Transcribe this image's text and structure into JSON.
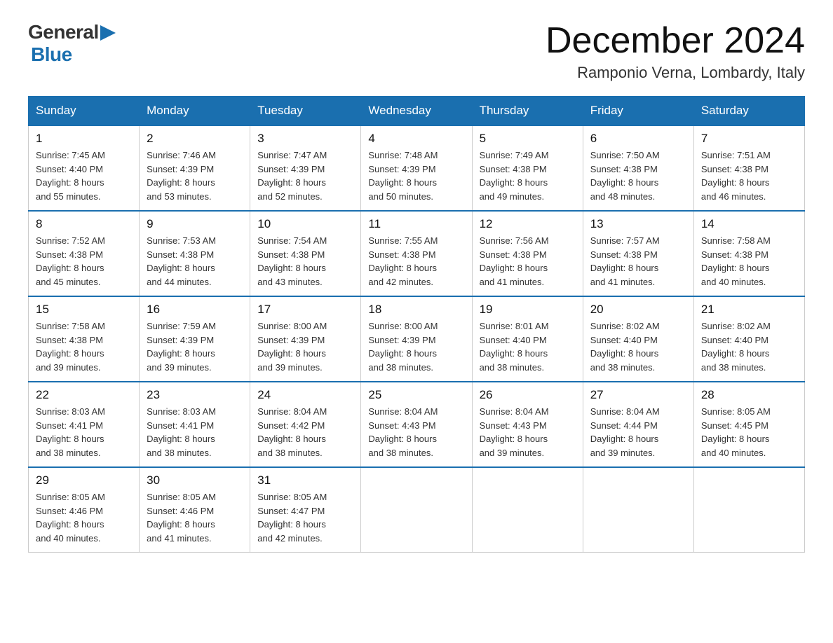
{
  "header": {
    "logo_general": "General",
    "logo_blue": "Blue",
    "month_title": "December 2024",
    "location": "Ramponio Verna, Lombardy, Italy"
  },
  "days_of_week": [
    "Sunday",
    "Monday",
    "Tuesday",
    "Wednesday",
    "Thursday",
    "Friday",
    "Saturday"
  ],
  "weeks": [
    [
      {
        "day": "1",
        "sunrise": "7:45 AM",
        "sunset": "4:40 PM",
        "daylight": "8 hours and 55 minutes."
      },
      {
        "day": "2",
        "sunrise": "7:46 AM",
        "sunset": "4:39 PM",
        "daylight": "8 hours and 53 minutes."
      },
      {
        "day": "3",
        "sunrise": "7:47 AM",
        "sunset": "4:39 PM",
        "daylight": "8 hours and 52 minutes."
      },
      {
        "day": "4",
        "sunrise": "7:48 AM",
        "sunset": "4:39 PM",
        "daylight": "8 hours and 50 minutes."
      },
      {
        "day": "5",
        "sunrise": "7:49 AM",
        "sunset": "4:38 PM",
        "daylight": "8 hours and 49 minutes."
      },
      {
        "day": "6",
        "sunrise": "7:50 AM",
        "sunset": "4:38 PM",
        "daylight": "8 hours and 48 minutes."
      },
      {
        "day": "7",
        "sunrise": "7:51 AM",
        "sunset": "4:38 PM",
        "daylight": "8 hours and 46 minutes."
      }
    ],
    [
      {
        "day": "8",
        "sunrise": "7:52 AM",
        "sunset": "4:38 PM",
        "daylight": "8 hours and 45 minutes."
      },
      {
        "day": "9",
        "sunrise": "7:53 AM",
        "sunset": "4:38 PM",
        "daylight": "8 hours and 44 minutes."
      },
      {
        "day": "10",
        "sunrise": "7:54 AM",
        "sunset": "4:38 PM",
        "daylight": "8 hours and 43 minutes."
      },
      {
        "day": "11",
        "sunrise": "7:55 AM",
        "sunset": "4:38 PM",
        "daylight": "8 hours and 42 minutes."
      },
      {
        "day": "12",
        "sunrise": "7:56 AM",
        "sunset": "4:38 PM",
        "daylight": "8 hours and 41 minutes."
      },
      {
        "day": "13",
        "sunrise": "7:57 AM",
        "sunset": "4:38 PM",
        "daylight": "8 hours and 41 minutes."
      },
      {
        "day": "14",
        "sunrise": "7:58 AM",
        "sunset": "4:38 PM",
        "daylight": "8 hours and 40 minutes."
      }
    ],
    [
      {
        "day": "15",
        "sunrise": "7:58 AM",
        "sunset": "4:38 PM",
        "daylight": "8 hours and 39 minutes."
      },
      {
        "day": "16",
        "sunrise": "7:59 AM",
        "sunset": "4:39 PM",
        "daylight": "8 hours and 39 minutes."
      },
      {
        "day": "17",
        "sunrise": "8:00 AM",
        "sunset": "4:39 PM",
        "daylight": "8 hours and 39 minutes."
      },
      {
        "day": "18",
        "sunrise": "8:00 AM",
        "sunset": "4:39 PM",
        "daylight": "8 hours and 38 minutes."
      },
      {
        "day": "19",
        "sunrise": "8:01 AM",
        "sunset": "4:40 PM",
        "daylight": "8 hours and 38 minutes."
      },
      {
        "day": "20",
        "sunrise": "8:02 AM",
        "sunset": "4:40 PM",
        "daylight": "8 hours and 38 minutes."
      },
      {
        "day": "21",
        "sunrise": "8:02 AM",
        "sunset": "4:40 PM",
        "daylight": "8 hours and 38 minutes."
      }
    ],
    [
      {
        "day": "22",
        "sunrise": "8:03 AM",
        "sunset": "4:41 PM",
        "daylight": "8 hours and 38 minutes."
      },
      {
        "day": "23",
        "sunrise": "8:03 AM",
        "sunset": "4:41 PM",
        "daylight": "8 hours and 38 minutes."
      },
      {
        "day": "24",
        "sunrise": "8:04 AM",
        "sunset": "4:42 PM",
        "daylight": "8 hours and 38 minutes."
      },
      {
        "day": "25",
        "sunrise": "8:04 AM",
        "sunset": "4:43 PM",
        "daylight": "8 hours and 38 minutes."
      },
      {
        "day": "26",
        "sunrise": "8:04 AM",
        "sunset": "4:43 PM",
        "daylight": "8 hours and 39 minutes."
      },
      {
        "day": "27",
        "sunrise": "8:04 AM",
        "sunset": "4:44 PM",
        "daylight": "8 hours and 39 minutes."
      },
      {
        "day": "28",
        "sunrise": "8:05 AM",
        "sunset": "4:45 PM",
        "daylight": "8 hours and 40 minutes."
      }
    ],
    [
      {
        "day": "29",
        "sunrise": "8:05 AM",
        "sunset": "4:46 PM",
        "daylight": "8 hours and 40 minutes."
      },
      {
        "day": "30",
        "sunrise": "8:05 AM",
        "sunset": "4:46 PM",
        "daylight": "8 hours and 41 minutes."
      },
      {
        "day": "31",
        "sunrise": "8:05 AM",
        "sunset": "4:47 PM",
        "daylight": "8 hours and 42 minutes."
      },
      null,
      null,
      null,
      null
    ]
  ],
  "labels": {
    "sunrise": "Sunrise:",
    "sunset": "Sunset:",
    "daylight": "Daylight:"
  }
}
